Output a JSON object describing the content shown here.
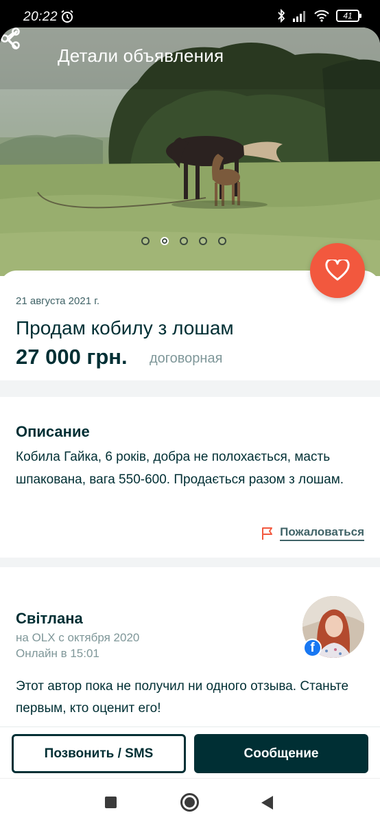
{
  "status_bar": {
    "time": "20:22",
    "battery": "41",
    "icons": [
      "alarm-icon",
      "bluetooth-icon",
      "signal-icon",
      "wifi-icon",
      "battery-icon"
    ]
  },
  "header": {
    "title": "Детали объявления",
    "back_icon": "back-arrow-icon",
    "share_icon": "share-icon"
  },
  "gallery": {
    "image_count": 5,
    "active_index": 1
  },
  "listing": {
    "date": "21 августа 2021 г.",
    "title": "Продам кобилу з лошам",
    "price": "27 000 грн.",
    "price_note": "договорная",
    "favorite_icon": "heart-icon"
  },
  "description": {
    "heading": "Описание",
    "text": "Кобила Гайка, 6 років, добра не полохається, масть шпакована, вага 550-600. Продається разом з лошам.",
    "report_label": "Пожаловаться"
  },
  "seller": {
    "name": "Світлана",
    "member_since": "на OLX с октября 2020",
    "last_online": "Онлайн в 15:01",
    "review_text": "Этот автор пока не получил ни одного отзыва. Станьте первым, кто оценит его!",
    "facebook_badge": "f"
  },
  "actions": {
    "call_label": "Позвонить / SMS",
    "message_label": "Сообщение"
  },
  "colors": {
    "primary": "#002f34",
    "accent": "#f2583e",
    "muted": "#7f9799"
  }
}
